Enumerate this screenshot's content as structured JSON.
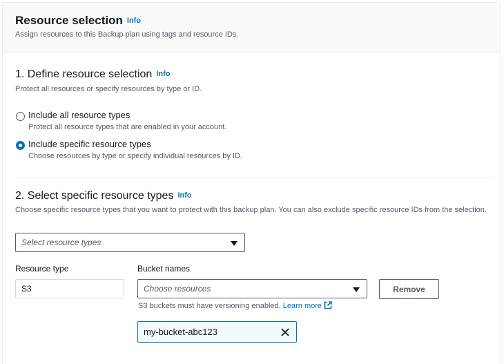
{
  "section": {
    "title": "Resource selection",
    "info": "Info",
    "description": "Assign resources to this Backup plan using tags and resource IDs."
  },
  "step1": {
    "title": "1. Define resource selection",
    "info": "Info",
    "description": "Protect all resources or specify resources by type or ID.",
    "options": [
      {
        "label": "Include all resource types",
        "description": "Protect all resource types that are enabled in your account.",
        "selected": false
      },
      {
        "label": "Include specific resource types",
        "description": "Choose resources by type or specify individual resources by ID.",
        "selected": true
      }
    ]
  },
  "step2": {
    "title": "2. Select specific resource types",
    "info": "Info",
    "description": "Choose specific resource types that you want to protect with this backup plan. You can also exclude specific resource IDs from the selection.",
    "type_select_placeholder": "Select resource types",
    "resource_type_label": "Resource type",
    "bucket_names_label": "Bucket names",
    "resource_type_value": "S3",
    "bucket_select_placeholder": "Choose resources",
    "remove_label": "Remove",
    "hint_text": "S3 buckets must have versioning enabled.",
    "learn_more": "Learn more",
    "selected_bucket": "my-bucket-abc123"
  },
  "colors": {
    "accent": "#0073bb",
    "text": "#16191f",
    "secondary_text": "#545b64",
    "border": "#eaeded"
  }
}
